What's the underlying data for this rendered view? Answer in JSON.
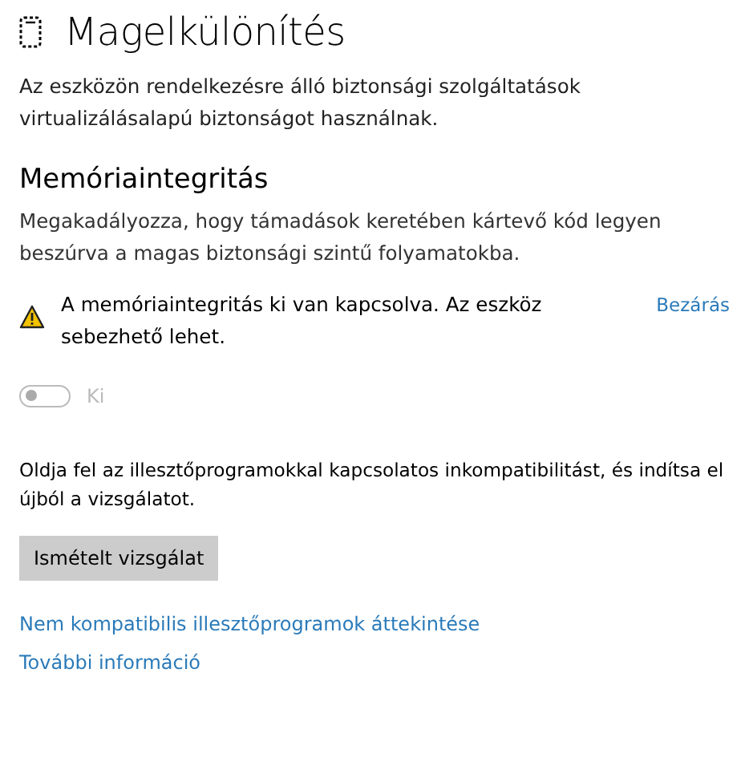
{
  "header": {
    "title": "Magelkülönítés",
    "description": "Az eszközön rendelkezésre álló biztonsági szolgáltatások virtualizálásalapú biztonságot használnak."
  },
  "section": {
    "title": "Memóriaintegritás",
    "description": "Megakadályozza, hogy támadások keretében kártevő kód legyen beszúrva a magas biztonsági szintű folyamatokba."
  },
  "warning": {
    "message": "A memóriaintegritás ki van kapcsolva. Az eszköz sebezhető lehet.",
    "dismiss": "Bezárás"
  },
  "toggle": {
    "label": "Ki",
    "on": false,
    "disabled": true
  },
  "instruction": "Oldja fel az illesztőprogramokkal kapcsolatos inkompatibilitást, és indítsa el újból a vizsgálatot.",
  "button": "Ismételt vizsgálat",
  "links": [
    "Nem kompatibilis illesztőprogramok áttekintése",
    "További információ"
  ]
}
